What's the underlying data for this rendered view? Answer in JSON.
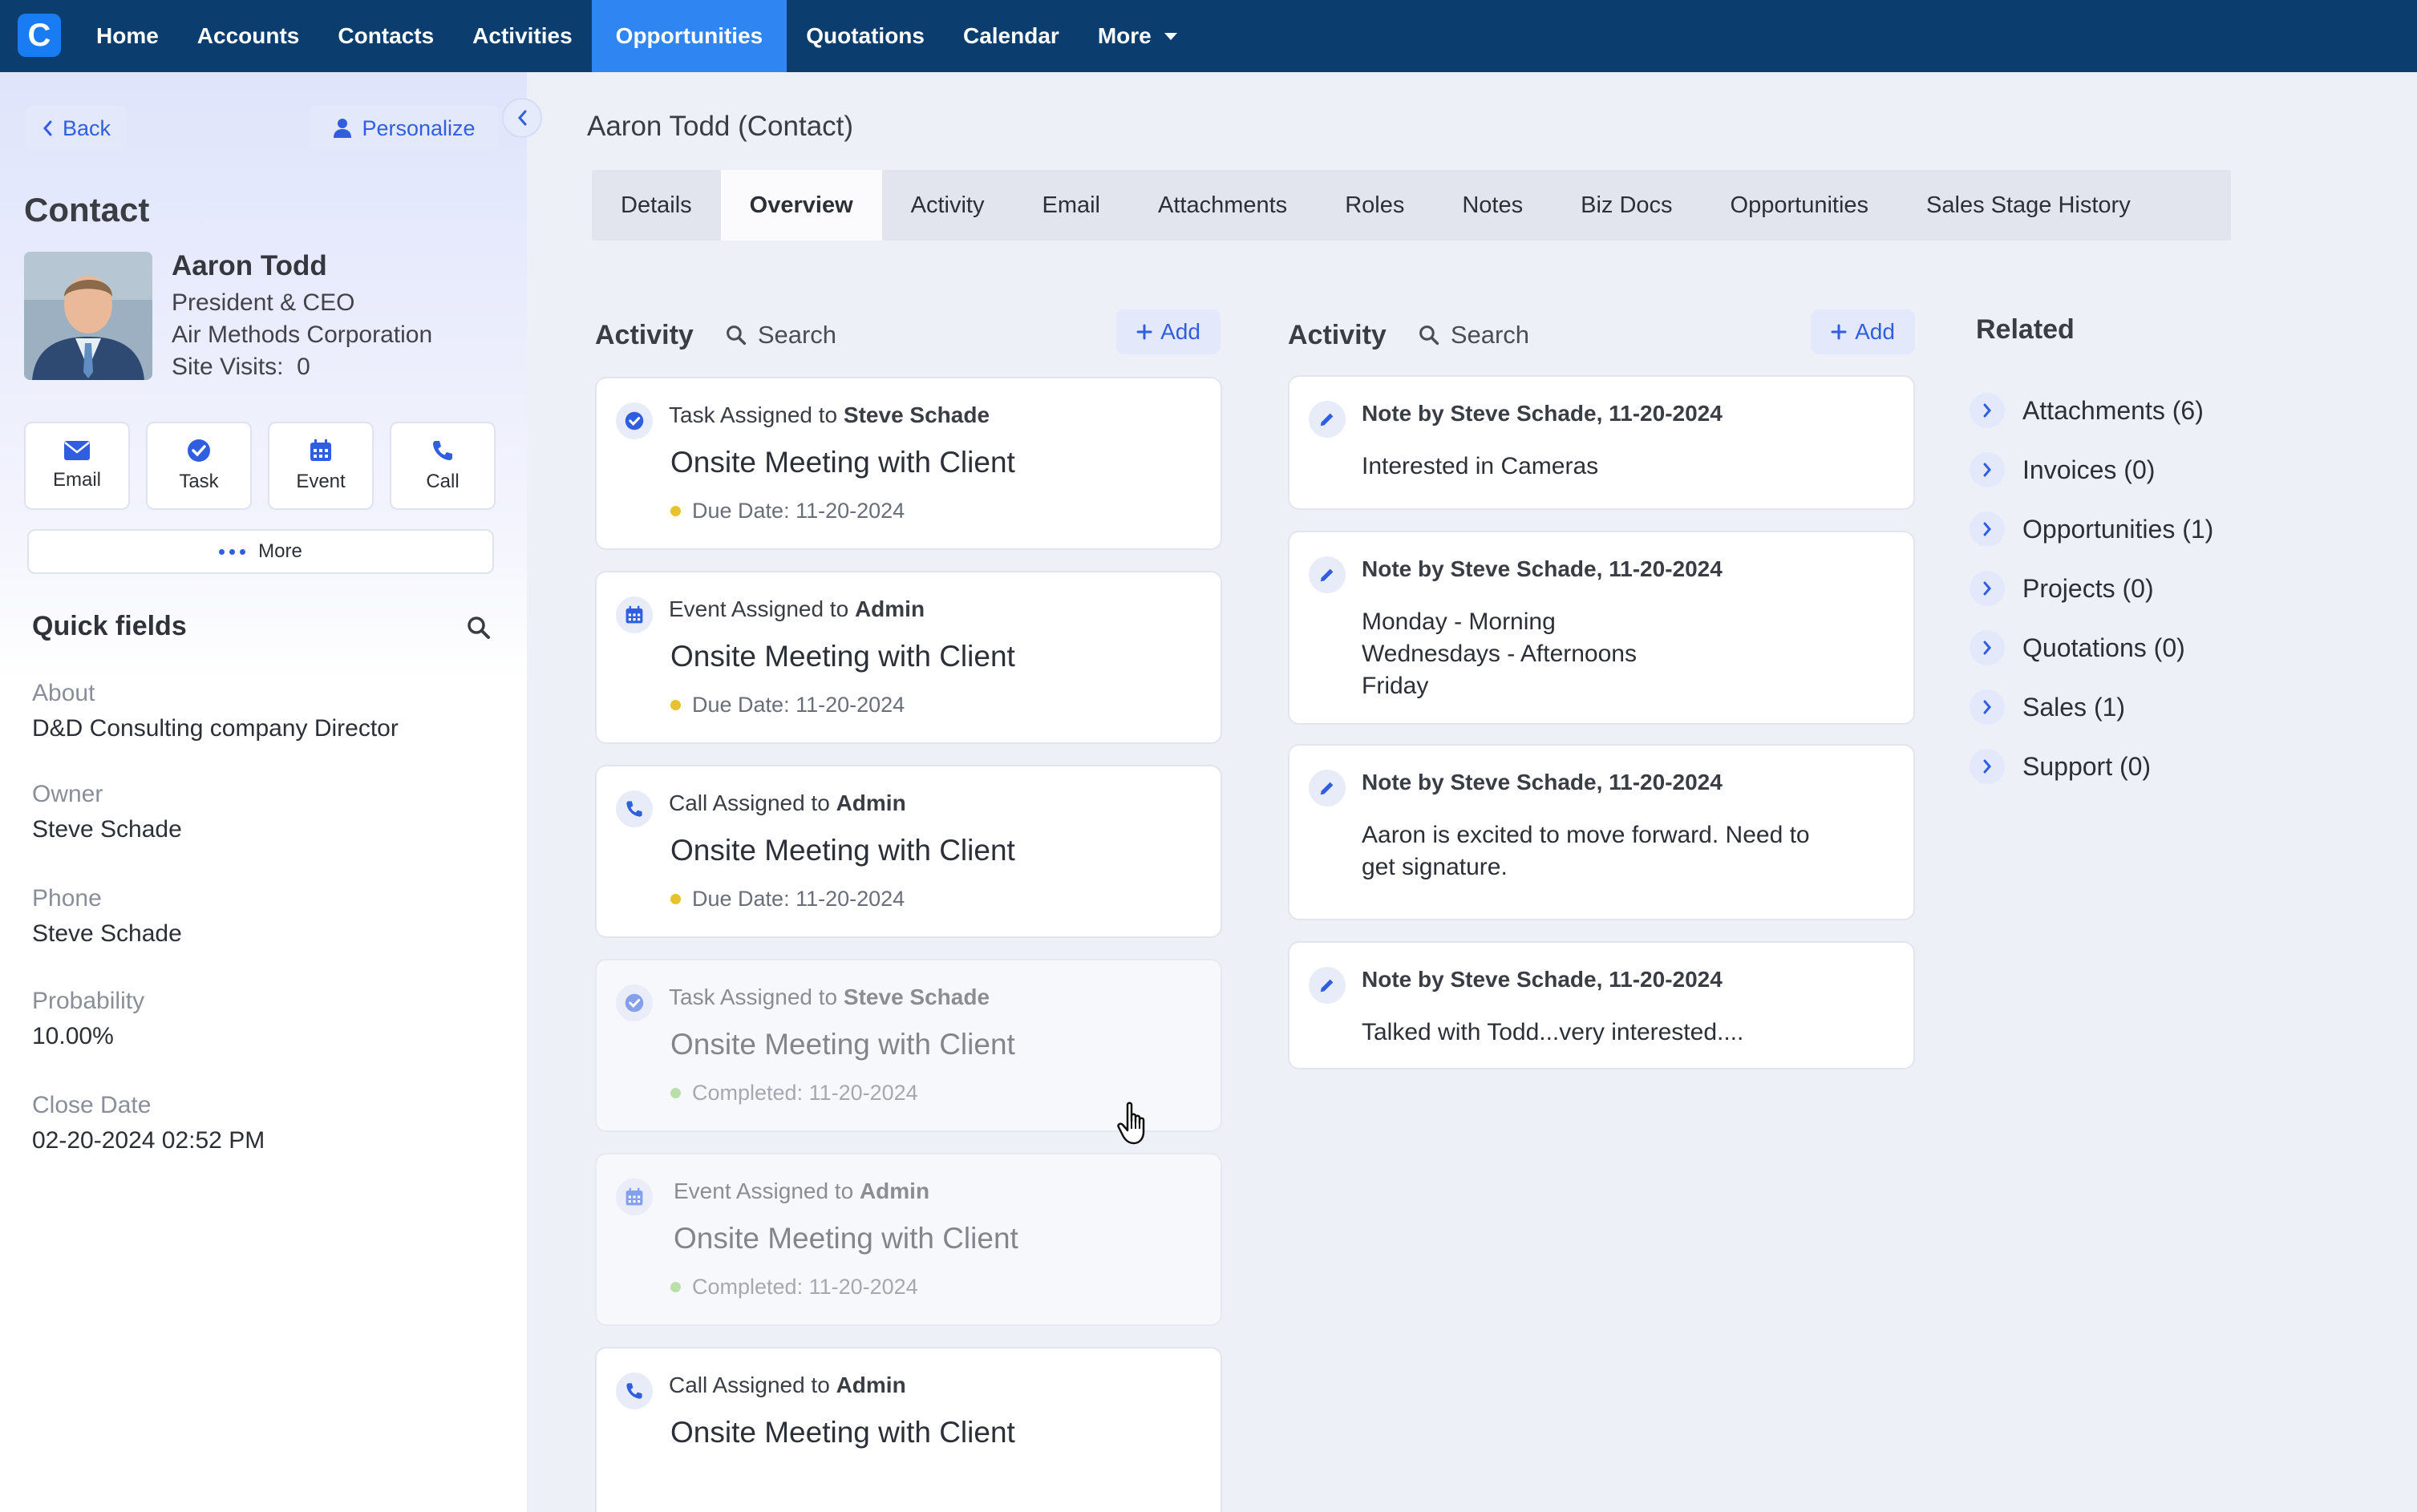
{
  "nav": {
    "logo_letter": "C",
    "items": [
      "Home",
      "Accounts",
      "Contacts",
      "Activities",
      "Opportunities",
      "Quotations",
      "Calendar",
      "More"
    ],
    "active": "Opportunities"
  },
  "sidebar": {
    "back_label": "Back",
    "personalize_label": "Personalize",
    "heading": "Contact",
    "contact": {
      "name": "Aaron Todd",
      "title": "President & CEO",
      "company": "Air Methods Corporation",
      "site_visits": "Site Visits:  0"
    },
    "actions": [
      "Email",
      "Task",
      "Event",
      "Call"
    ],
    "more_label": "More",
    "quick_fields_title": "Quick fields",
    "quick_fields": [
      {
        "label": "About",
        "value": "D&D Consulting company Director"
      },
      {
        "label": "Owner",
        "value": "Steve Schade"
      },
      {
        "label": "Phone",
        "value": "Steve Schade"
      },
      {
        "label": "Probability",
        "value": "10.00%"
      },
      {
        "label": "Close Date",
        "value": "02-20-2024 02:52 PM"
      }
    ]
  },
  "main": {
    "page_title": "Aaron Todd (Contact)",
    "tabs": [
      "Details",
      "Overview",
      "Activity",
      "Email",
      "Attachments",
      "Roles",
      "Notes",
      "Biz Docs",
      "Opportunities",
      "Sales Stage History"
    ],
    "active_tab": "Overview",
    "activity_col": {
      "title": "Activity",
      "search_label": "Search",
      "add_label": "Add",
      "cards": [
        {
          "type_word": "Task",
          "assign_text": " Assigned to ",
          "assignee": "Steve Schade",
          "title": "Onsite Meeting with Client",
          "meta": "Due Date: 11-20-2024",
          "status": "due",
          "icon": "task-check-icon"
        },
        {
          "type_word": "Event",
          "assign_text": " Assigned to ",
          "assignee": "Admin",
          "title": "Onsite Meeting with Client",
          "meta": "Due Date: 11-20-2024",
          "status": "due",
          "icon": "calendar-icon"
        },
        {
          "type_word": "Call",
          "assign_text": " Assigned to ",
          "assignee": "Admin",
          "title": "Onsite Meeting with Client",
          "meta": "Due Date: 11-20-2024",
          "status": "due",
          "icon": "phone-icon"
        },
        {
          "type_word": "Task",
          "assign_text": " Assigned to ",
          "assignee": "Steve Schade",
          "title": "Onsite Meeting with Client",
          "meta": "Completed: 11-20-2024",
          "status": "completed",
          "icon": "task-check-icon"
        },
        {
          "type_word": "Event",
          "assign_text": " Assigned to ",
          "assignee": "Admin",
          "title": "Onsite Meeting with Client",
          "meta": "Completed: 11-20-2024",
          "status": "completed",
          "icon": "calendar-icon"
        },
        {
          "type_word": "Call",
          "assign_text": " Assigned to ",
          "assignee": "Admin",
          "title": "Onsite Meeting with Client",
          "meta": "",
          "status": "due",
          "icon": "phone-icon"
        }
      ]
    },
    "notes_col": {
      "title": "Activity",
      "search_label": "Search",
      "add_label": "Add",
      "notes": [
        {
          "head_prefix": "Note",
          "head_rest": " by Steve Schade, 11-20-2024",
          "lines": [
            "Interested in Cameras"
          ]
        },
        {
          "head_prefix": "Note",
          "head_rest": " by Steve Schade, 11-20-2024",
          "lines": [
            "Monday - Morning",
            "Wednesdays - Afternoons",
            "Friday"
          ]
        },
        {
          "head_prefix": "Note",
          "head_rest": " by Steve Schade, 11-20-2024",
          "lines": [
            "Aaron is excited to move forward. Need to",
            "get signature."
          ]
        },
        {
          "head_prefix": "Note",
          "head_rest": " by Steve Schade, 11-20-2024",
          "lines": [
            "Talked with Todd...very interested...."
          ]
        }
      ]
    },
    "related": {
      "title": "Related",
      "items": [
        "Attachments (6)",
        "Invoices (0)",
        "Opportunities (1)",
        "Projects (0)",
        "Quotations (0)",
        "Sales (1)",
        "Support (0)"
      ]
    }
  },
  "colors": {
    "nav_bg": "#0b3d6f",
    "nav_active": "#2f86f2",
    "accent": "#2f5fe0",
    "due_dot": "#e6c22e",
    "completed_dot": "#8fd36a"
  }
}
